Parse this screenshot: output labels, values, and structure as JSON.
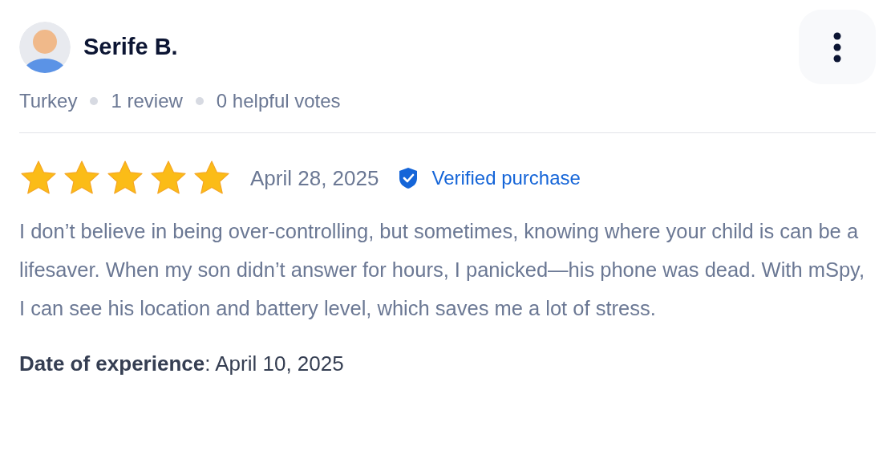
{
  "reviewer": {
    "name": "Serife B.",
    "meta": [
      "Turkey",
      "1 review",
      "0 helpful votes"
    ]
  },
  "review": {
    "stars": 5,
    "date": "April 28, 2025",
    "verified": true,
    "verified_label": "Verified purchase",
    "body": "I don’t believe in being over-controlling, but sometimes, knowing where your child is can be a lifesaver. When my son didn’t answer for hours, I panicked—his phone was dead. With mSpy, I can see his location and battery level, which saves me a lot of stress."
  },
  "experience": {
    "text": "**Date of experience**: April 10, 2025"
  }
}
